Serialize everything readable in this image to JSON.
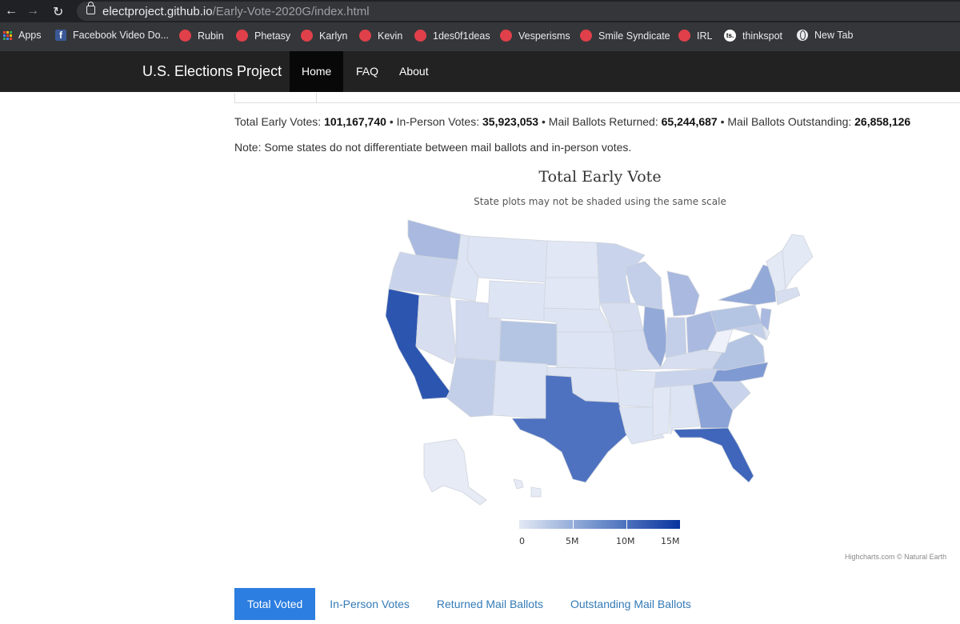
{
  "browser": {
    "url_host": "electproject.github.io",
    "url_path": "/Early-Vote-2020G/index.html",
    "bookmarks": [
      {
        "label": "Apps",
        "icon": "apps-grid-icon"
      },
      {
        "label": "Facebook Video Do...",
        "icon": "facebook-icon"
      },
      {
        "label": "Rubin",
        "icon": "red-dot-icon"
      },
      {
        "label": "Phetasy",
        "icon": "red-dot-icon"
      },
      {
        "label": "Karlyn",
        "icon": "red-dot-icon"
      },
      {
        "label": "Kevin",
        "icon": "red-dot-icon"
      },
      {
        "label": "1des0f1deas",
        "icon": "red-dot-icon"
      },
      {
        "label": "Vesperisms",
        "icon": "red-dot-icon"
      },
      {
        "label": "Smile Syndicate",
        "icon": "red-dot-icon"
      },
      {
        "label": "IRL",
        "icon": "red-dot-icon"
      },
      {
        "label": "thinkspot",
        "icon": "ts-icon",
        "icon_text": "ts."
      },
      {
        "label": "New Tab",
        "icon": "globe-icon"
      }
    ]
  },
  "nav": {
    "brand": "U.S. Elections Project",
    "links": [
      "Home",
      "FAQ",
      "About"
    ]
  },
  "stats": {
    "total_label": "Total Early Votes:",
    "total": "101,167,740",
    "inperson_label": "In-Person Votes:",
    "inperson": "35,923,053",
    "returned_label": "Mail Ballots Returned:",
    "returned": "65,244,687",
    "outstanding_label": "Mail Ballots Outstanding:",
    "outstanding": "26,858,126",
    "separator": "•"
  },
  "note": "Note: Some states do not differentiate between mail ballots and in-person votes.",
  "chart_data": {
    "type": "choropleth",
    "title": "Total Early Vote",
    "subtitle": "State plots may not be shaded using the same scale",
    "color_axis": {
      "min": 0,
      "max": 15000000,
      "ticks": [
        "0",
        "5M",
        "10M",
        "15M"
      ],
      "min_color": "#e3e9f5",
      "max_color": "#08349f"
    },
    "credits": "Highcharts.com © Natural Earth"
  },
  "tabs": [
    "Total Voted",
    "In-Person Votes",
    "Returned Mail Ballots",
    "Outstanding Mail Ballots"
  ],
  "colors": {
    "navbar": "#222222",
    "active_tab": "#2c7ee1",
    "link": "#337ab7"
  }
}
